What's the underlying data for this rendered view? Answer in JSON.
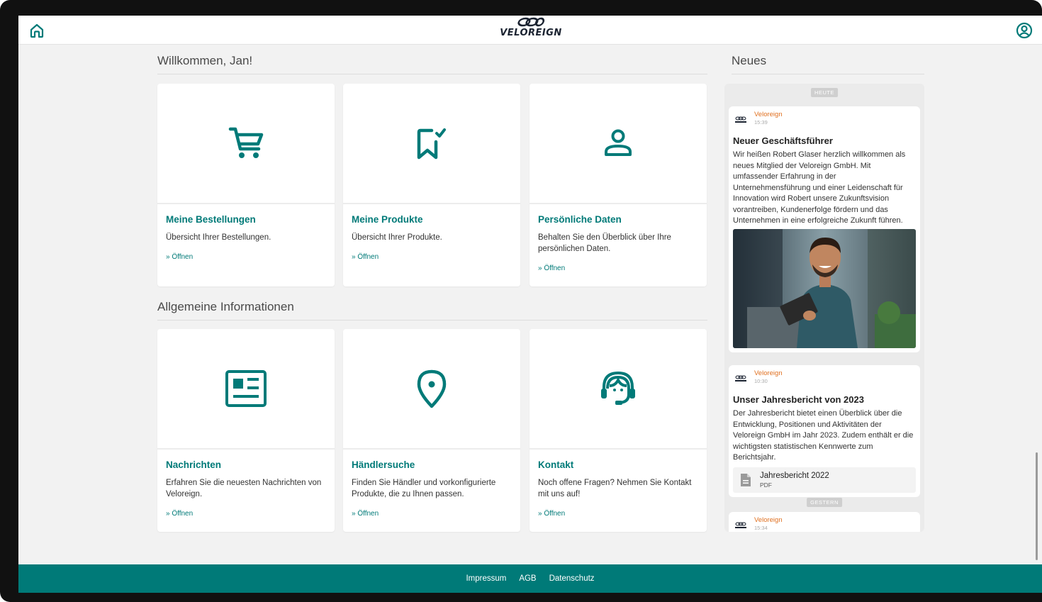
{
  "header": {
    "brand": "VELOREIGN",
    "brand_color": "#007a78"
  },
  "welcome": {
    "title": "Willkommen, Jan!",
    "cards": [
      {
        "icon": "cart-icon",
        "title": "Meine Bestellungen",
        "description": "Übersicht Ihrer Bestellungen.",
        "link": "» Öffnen"
      },
      {
        "icon": "bookmark-check-icon",
        "title": "Meine Produkte",
        "description": "Übersicht Ihrer Produkte.",
        "link": "» Öffnen"
      },
      {
        "icon": "user-icon",
        "title": "Persönliche Daten",
        "description": "Behalten Sie den Überblick über Ihre persönlichen Daten.",
        "link": "» Öffnen"
      }
    ]
  },
  "info": {
    "title": "Allgemeine Informationen",
    "cards": [
      {
        "icon": "newspaper-icon",
        "title": "Nachrichten",
        "description": "Erfahren Sie die neuesten Nachrichten von Veloreign.",
        "link": "» Öffnen"
      },
      {
        "icon": "map-pin-icon",
        "title": "Händlersuche",
        "description": "Finden Sie Händler und vorkonfigurierte Produkte, die zu Ihnen passen.",
        "link": "» Öffnen"
      },
      {
        "icon": "headset-icon",
        "title": "Kontakt",
        "description": "Noch offene Fragen? Nehmen Sie Kontakt mit uns auf!",
        "link": "» Öffnen"
      }
    ]
  },
  "news": {
    "title": "Neues",
    "day_today": "HEUTE",
    "day_yesterday": "GESTERN",
    "items": [
      {
        "author": "Veloreign",
        "time": "15:39",
        "heading": "Neuer Geschäftsführer",
        "text": "Wir heißen Robert Glaser herzlich willkommen als neues Mitglied der Veloreign GmbH. Mit umfassender Erfahrung in der Unternehmensführung und einer Leidenschaft für Innovation wird Robert unsere Zukunftsvision vorantreiben, Kundenerfolge fördern und das Unternehmen in eine erfolgreiche Zukunft führen."
      },
      {
        "author": "Veloreign",
        "time": "10:30",
        "heading": "Unser Jahresbericht von 2023",
        "text": "Der Jahresbericht bietet einen Überblick über die Entwicklung, Positionen und Aktivitäten der Veloreign GmbH im Jahr 2023. Zudem enthält er die wichtigsten statistischen Kennwerte zum Berichtsjahr.",
        "attachment": {
          "name": "Jahresbericht 2022",
          "type": "PDF",
          "icon": "document-icon"
        }
      },
      {
        "author": "Veloreign",
        "time": "15:34"
      }
    ]
  },
  "footer": {
    "links": [
      "Impressum",
      "AGB",
      "Datenschutz"
    ]
  }
}
